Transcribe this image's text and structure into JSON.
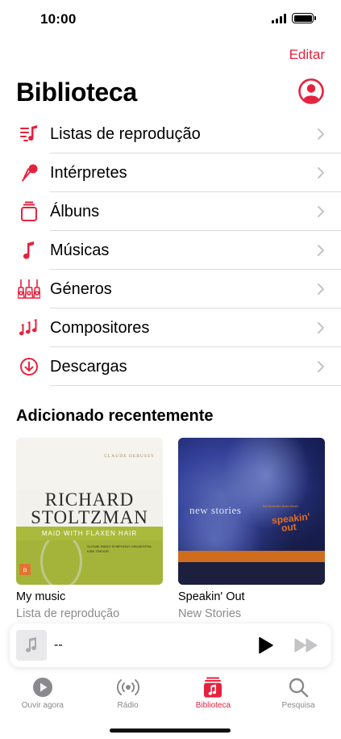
{
  "status_bar": {
    "time": "10:00"
  },
  "header": {
    "edit_label": "Editar",
    "title": "Biblioteca"
  },
  "library_items": [
    {
      "label": "Listas de reprodução",
      "icon": "playlist-icon"
    },
    {
      "label": "Intérpretes",
      "icon": "microphone-icon"
    },
    {
      "label": "Álbuns",
      "icon": "album-stack-icon"
    },
    {
      "label": "Músicas",
      "icon": "music-note-icon"
    },
    {
      "label": "Géneros",
      "icon": "guitars-icon"
    },
    {
      "label": "Compositores",
      "icon": "notes-icon"
    },
    {
      "label": "Descargas",
      "icon": "download-icon"
    }
  ],
  "recent": {
    "title": "Adicionado recentemente",
    "albums": [
      {
        "title": "My music",
        "subtitle": "Lista de reprodução",
        "art_text": {
          "composer": "CLAUDE DEBUSSY",
          "line1": "RICHARD",
          "line2": "STOLTZMAN",
          "banner": "MAID WITH FLAXEN HAIR",
          "small1": "SLOVAK RADIO SYMPHONY ORCHESTRA",
          "small2": "KIRK TREVOR",
          "logo": "n"
        }
      },
      {
        "title": "Speakin' Out",
        "subtitle": "New Stories",
        "art_text": {
          "small": "Ted Brancato Bass Music",
          "line1": "new stories",
          "line2": "speakin'",
          "line3": "out"
        }
      }
    ]
  },
  "mini_player": {
    "title": "--"
  },
  "tabs": [
    {
      "label": "Ouvir agora",
      "active": false
    },
    {
      "label": "Rádio",
      "active": false
    },
    {
      "label": "Biblioteca",
      "active": true
    },
    {
      "label": "Pesquisa",
      "active": false
    }
  ],
  "colors": {
    "accent": "#e5223e",
    "secondary_text": "#8a8a8e",
    "tab_bar": "#f2f2f4"
  }
}
